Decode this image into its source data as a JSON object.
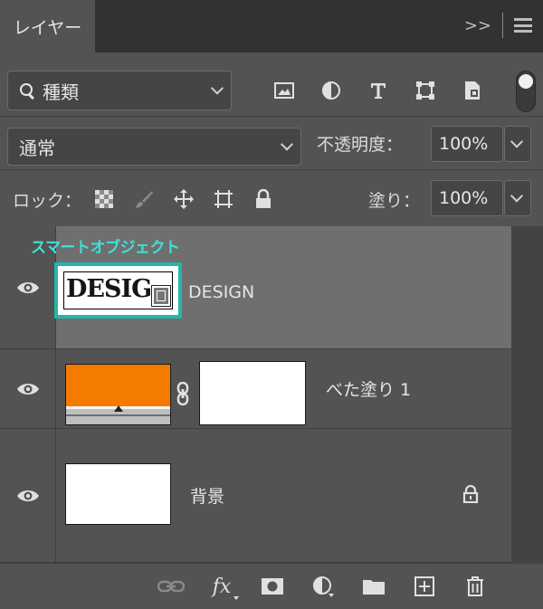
{
  "panel": {
    "tab_label": "レイヤー",
    "collapse_glyph": ">>"
  },
  "filter": {
    "label": "種類",
    "icons": [
      "image-filter-icon",
      "adjustment-filter-icon",
      "type-filter-icon",
      "shape-filter-icon",
      "smart-object-filter-icon"
    ]
  },
  "blend": {
    "mode": "通常",
    "opacity_label": "不透明度：",
    "opacity_value": "100%"
  },
  "lock": {
    "label": "ロック：",
    "fill_label": "塗り：",
    "fill_value": "100%"
  },
  "annotation": {
    "smart_object_label": "スマートオブジェクト",
    "color": "#23b7aa"
  },
  "layers": [
    {
      "name": "DESIGN",
      "thumb_text": "DESIG",
      "type": "smart-object",
      "selected": true
    },
    {
      "name": "べた塗り 1",
      "type": "fill",
      "fill_color": "#f57a00"
    },
    {
      "name": "背景",
      "type": "background",
      "locked": true
    }
  ],
  "bottom_icons": [
    "link-icon",
    "fx-icon",
    "mask-icon",
    "adjustment-icon",
    "folder-icon",
    "new-layer-icon",
    "trash-icon"
  ],
  "bottom": {
    "fx_label": "fx"
  }
}
